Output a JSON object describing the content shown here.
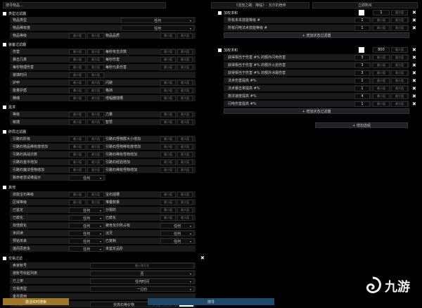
{
  "top": {
    "search": "搜寻物品...",
    "league": "《流放之路：降临》- 瓦尔的宿命",
    "trade_type": "立即购买"
  },
  "ph": {
    "min": "最小值",
    "max": "最大值"
  },
  "sec": {
    "type": "类型过滤器",
    "equip": "装备过滤器",
    "req": "需求",
    "endgame": "终局过滤器",
    "misc": "其他",
    "trade": "交易过滤"
  },
  "type_rows": [
    {
      "label": "物品类型",
      "value": "任何"
    },
    {
      "label": "物品稀有度",
      "value": "任何"
    }
  ],
  "type_level": {
    "label": "物品等级",
    "label2": "物品品质"
  },
  "equip_pairs": [
    {
      "l": "伤害",
      "r": "每秒攻击次数"
    },
    {
      "l": "暴击几率",
      "r": "每秒伤害"
    },
    {
      "l": "每秒物理伤害",
      "r": "每秒元素伤害"
    },
    {
      "l": "装填时间",
      "r": ""
    },
    {
      "l": "护甲",
      "r": "闪避"
    },
    {
      "l": "能量护盾",
      "r": "格挡"
    },
    {
      "l": "精魂",
      "r": "增幅器插槽"
    }
  ],
  "req_rows": [
    {
      "l": "等级",
      "r": "力量"
    },
    {
      "l": "敏捷",
      "r": "智慧"
    }
  ],
  "endgame_pairs": [
    {
      "l": "引路石阶级",
      "r": "引路石怪物群大小增加"
    },
    {
      "l": "引路石物品稀有度增加",
      "r": "引路石怪物稀有度增加"
    },
    {
      "l": "引路石挑战次数",
      "r": "引路石稀有怪物增加"
    },
    {
      "l": "引路石金币增加",
      "r": "引路石经验增加"
    },
    {
      "l": "引路石魔法怪物增加",
      "r": "引路石稀有怪物增加"
    }
  ],
  "endgame_last": {
    "label": "致命者尝试维提示",
    "value": "任何"
  },
  "misc": {
    "r1": {
      "l": "技能宝石等级",
      "r": "宝石插槽"
    },
    "r2": {
      "l": "区域等级",
      "r": "堆叠数量"
    },
    "r3": {
      "l": "已鉴定",
      "v": "任何",
      "r": "分裂的"
    },
    "r4": {
      "l": "已腐化",
      "v": "任何",
      "r": "已腐化"
    },
    "r5": {
      "l": "双倍腐化",
      "v": "任何",
      "r": "被肯瓦尔所占有",
      "rv": "任何"
    },
    "r6": {
      "l": "未阅读",
      "v": "任何",
      "r": "淡灵",
      "rv": "任何"
    },
    "r7": {
      "l": "预铭未来",
      "v": "任何",
      "r": "已复制",
      "rv": "任何"
    },
    "r8": {
      "l": "莲而思若永",
      "v": "任何",
      "r": "未鉴定品阶"
    }
  },
  "trade": {
    "seller": {
      "l": "卖家帐号",
      "ph": "输入账号名"
    },
    "listed": {
      "l": "按账号收起列表",
      "v": "否"
    },
    "online": {
      "l": "已上架",
      "v": "任何时间"
    },
    "market": {
      "l": "交易类型",
      "v": "一口价"
    },
    "price": {
      "l": "金币费用"
    },
    "buyout": {
      "l": "一口价",
      "v": "崇高石等价物",
      "num": "30"
    }
  },
  "right": {
    "b1": {
      "title": "加权求和",
      "min": "1",
      "max": "最大值",
      "items": [
        {
          "label": "所有未本技能等级 #",
          "num": "1"
        },
        {
          "label": "所有闪电法术技能等级 #",
          "num": "1"
        }
      ]
    },
    "add": "+ 增加状态过滤器",
    "b2": {
      "title": "加权求和",
      "min": "800",
      "max": "最大值",
      "items": [
        {
          "label": "获得相当于伤害 #% 的额外闪电伤害",
          "num": "3"
        },
        {
          "label": "获得相当于伤害 #% 的额外火焰伤害",
          "num": "3"
        },
        {
          "label": "获得相当于伤害 #% 的额外冰霜伤害",
          "num": "3"
        },
        {
          "label": "法术伤害提高 #%",
          "num": "1"
        },
        {
          "label": "法术暴击率提高 #%",
          "num": "1"
        },
        {
          "label": "施法速度提高 #%",
          "num": "4"
        },
        {
          "label": "闪电伤害提高 #%",
          "num": "1"
        }
      ]
    },
    "add2": "+ 增加状态过滤器",
    "addgroup": "+ 增加选组"
  },
  "bottom": {
    "left": "激活实时搜索",
    "search": "搜寻"
  },
  "watermark": {
    "glyph": "九游"
  }
}
